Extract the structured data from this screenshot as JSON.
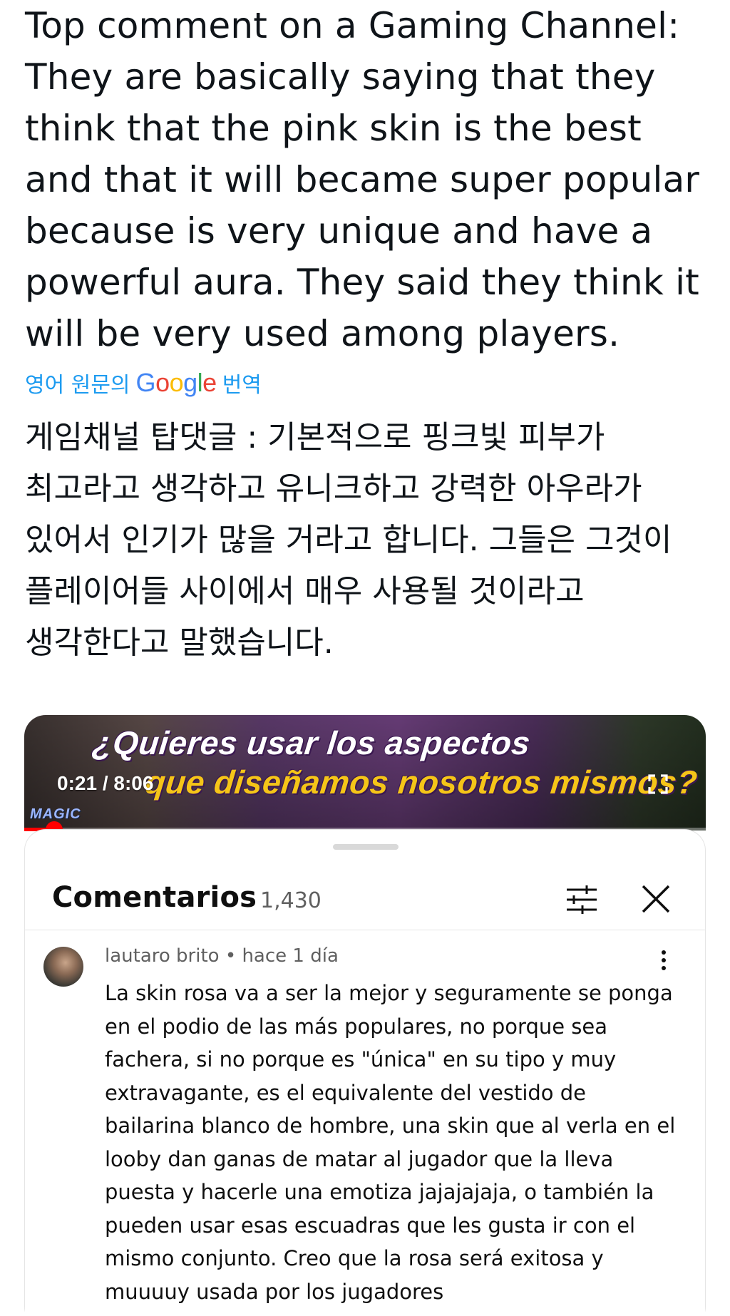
{
  "tweet": {
    "text": "Top comment on a Gaming Channel:\nThey are basically saying that they\nthink that the pink skin is the best\nand that it will became super popular\nbecause is very unique and have a\npowerful aura. They said they think it\nwill be very used among players.",
    "translate_prefix": "영어 원문의",
    "translate_brand": "Google",
    "translate_suffix": "번역",
    "translated_text": "게임채널 탑댓글 : 기본적으로 핑크빛 피부가\n최고라고 생각하고 유니크하고 강력한 아우라가\n있어서 인기가 많을 거라고 합니다. 그들은 그것이\n플레이어들 사이에서 매우 사용될 것이라고\n생각한다고 말했습니다."
  },
  "video": {
    "title_line1": "¿Quieres usar los aspectos",
    "title_line2": "que diseñamos nosotros mismos?",
    "time": "0:21 / 8:06",
    "logo_text": "MAGIC",
    "progress": 0.044
  },
  "comments_panel": {
    "title": "Comentarios",
    "count": "1,430",
    "comment": {
      "author": "lautaro brito",
      "separator": "•",
      "age": "hace 1 día",
      "text": "La skin rosa va a ser la mejor y seguramente se ponga\nen el podio de las más populares, no porque sea\nfachera, si no porque es \"única\" en su tipo y muy\nextravagante, es el equivalente del vestido de\nbailarina blanco de hombre, una skin que al verla en el\nlooby dan ganas de matar al jugador que la lleva\npuesta y hacerle una emotiza jajajajaja, o también la\npueden usar esas escuadras que les gusta ir con el\nmismo conjunto. Creo que la rosa será exitosa y\nmuuuuy usada por los jugadores"
    }
  },
  "colors": {
    "link_blue": "#1d9bf0",
    "progress_red": "#ff0000",
    "title_yellow": "#f5c518"
  }
}
